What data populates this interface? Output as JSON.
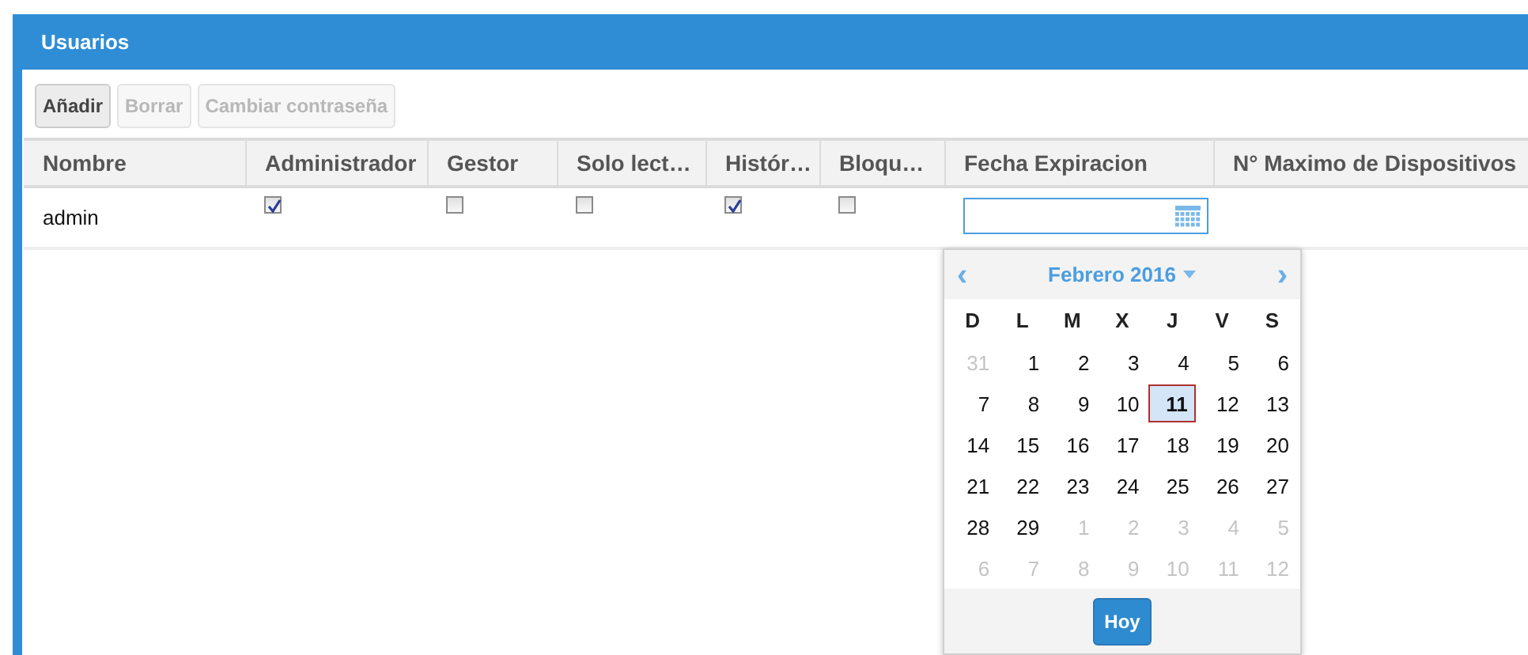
{
  "panel": {
    "title": "Usuarios"
  },
  "toolbar": [
    {
      "label": "Añadir",
      "disabled": false
    },
    {
      "label": "Borrar",
      "disabled": true
    },
    {
      "label": "Cambiar contraseña",
      "disabled": true
    }
  ],
  "table": {
    "columns": [
      "Nombre",
      "Administrador",
      "Gestor",
      "Solo lect…",
      "Histór…",
      "Bloqu…",
      "Fecha Expiracion",
      "N° Maximo de Dispositivos"
    ],
    "rows": [
      {
        "cells": [
          {
            "kind": "text",
            "text": "admin"
          },
          {
            "kind": "checkbox",
            "checked": true
          },
          {
            "kind": "checkbox",
            "checked": false
          },
          {
            "kind": "checkbox",
            "checked": false
          },
          {
            "kind": "checkbox",
            "checked": true
          },
          {
            "kind": "checkbox",
            "checked": false
          },
          {
            "kind": "date",
            "focused": true
          },
          {
            "kind": "empty"
          }
        ]
      }
    ]
  },
  "date_picker": {
    "prev": "‹",
    "next": "›",
    "month": "Febrero 2016",
    "weekdays": [
      "D",
      "L",
      "M",
      "X",
      "J",
      "V",
      "S"
    ],
    "weeks": [
      [
        {
          "day": "31",
          "other_month": true,
          "selected": false
        },
        {
          "day": "1",
          "other_month": false,
          "selected": false
        },
        {
          "day": "2",
          "other_month": false,
          "selected": false
        },
        {
          "day": "3",
          "other_month": false,
          "selected": false
        },
        {
          "day": "4",
          "other_month": false,
          "selected": false
        },
        {
          "day": "5",
          "other_month": false,
          "selected": false
        },
        {
          "day": "6",
          "other_month": false,
          "selected": false
        }
      ],
      [
        {
          "day": "7",
          "other_month": false,
          "selected": false
        },
        {
          "day": "8",
          "other_month": false,
          "selected": false
        },
        {
          "day": "9",
          "other_month": false,
          "selected": false
        },
        {
          "day": "10",
          "other_month": false,
          "selected": false
        },
        {
          "day": "11",
          "other_month": false,
          "selected": true
        },
        {
          "day": "12",
          "other_month": false,
          "selected": false
        },
        {
          "day": "13",
          "other_month": false,
          "selected": false
        }
      ],
      [
        {
          "day": "14",
          "other_month": false,
          "selected": false
        },
        {
          "day": "15",
          "other_month": false,
          "selected": false
        },
        {
          "day": "16",
          "other_month": false,
          "selected": false
        },
        {
          "day": "17",
          "other_month": false,
          "selected": false
        },
        {
          "day": "18",
          "other_month": false,
          "selected": false
        },
        {
          "day": "19",
          "other_month": false,
          "selected": false
        },
        {
          "day": "20",
          "other_month": false,
          "selected": false
        }
      ],
      [
        {
          "day": "21",
          "other_month": false,
          "selected": false
        },
        {
          "day": "22",
          "other_month": false,
          "selected": false
        },
        {
          "day": "23",
          "other_month": false,
          "selected": false
        },
        {
          "day": "24",
          "other_month": false,
          "selected": false
        },
        {
          "day": "25",
          "other_month": false,
          "selected": false
        },
        {
          "day": "26",
          "other_month": false,
          "selected": false
        },
        {
          "day": "27",
          "other_month": false,
          "selected": false
        }
      ],
      [
        {
          "day": "28",
          "other_month": false,
          "selected": false
        },
        {
          "day": "29",
          "other_month": false,
          "selected": false
        },
        {
          "day": "1",
          "other_month": true,
          "selected": false
        },
        {
          "day": "2",
          "other_month": true,
          "selected": false
        },
        {
          "day": "3",
          "other_month": true,
          "selected": false
        },
        {
          "day": "4",
          "other_month": true,
          "selected": false
        },
        {
          "day": "5",
          "other_month": true,
          "selected": false
        }
      ],
      [
        {
          "day": "6",
          "other_month": true,
          "selected": false
        },
        {
          "day": "7",
          "other_month": true,
          "selected": false
        },
        {
          "day": "8",
          "other_month": true,
          "selected": false
        },
        {
          "day": "9",
          "other_month": true,
          "selected": false
        },
        {
          "day": "10",
          "other_month": true,
          "selected": false
        },
        {
          "day": "11",
          "other_month": true,
          "selected": false
        },
        {
          "day": "12",
          "other_month": true,
          "selected": false
        }
      ]
    ],
    "today_button": "Hoy"
  }
}
